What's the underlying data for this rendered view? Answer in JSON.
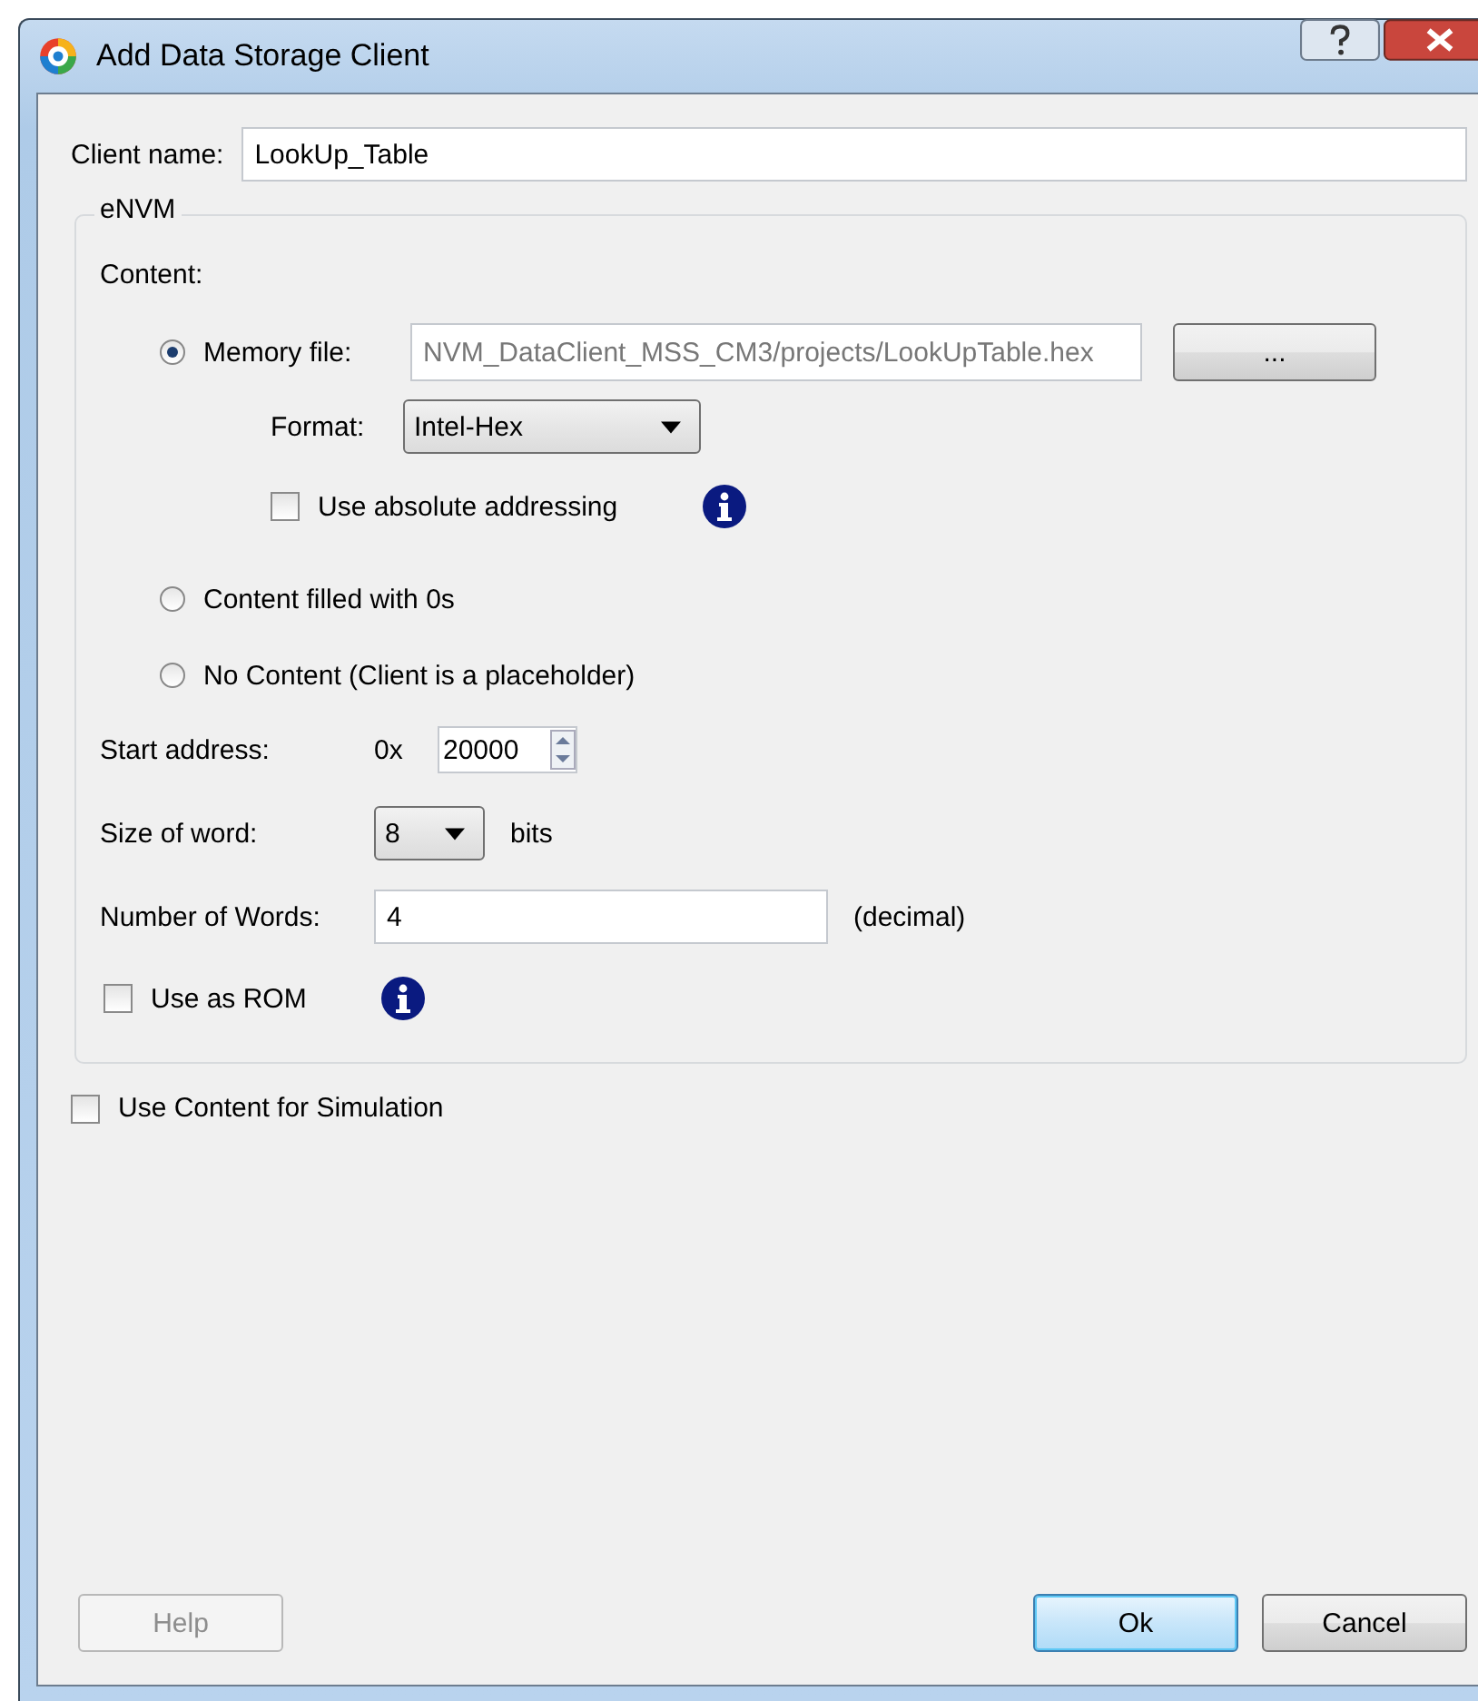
{
  "window": {
    "title": "Add Data Storage Client"
  },
  "client_name": {
    "label": "Client name:",
    "value": "LookUp_Table"
  },
  "group": {
    "title": "eNVM",
    "content_label": "Content:",
    "options": [
      {
        "kind": "file",
        "label": "Memory file:",
        "selected": true,
        "file_value": "NVM_DataClient_MSS_CM3/projects/LookUpTable.hex",
        "browse_label": "...",
        "format_label": "Format:",
        "format_value": "Intel-Hex",
        "absolute": {
          "label": "Use absolute addressing",
          "checked": false
        }
      },
      {
        "kind": "plain",
        "label": "Content filled with 0s",
        "selected": false
      },
      {
        "kind": "plain",
        "label": "No Content (Client is a placeholder)",
        "selected": false
      }
    ],
    "start_address": {
      "label": "Start address:",
      "prefix": "0x",
      "value": "20000"
    },
    "word_size": {
      "label": "Size of word:",
      "value": "8",
      "unit": "bits"
    },
    "number_of_words": {
      "label": "Number of Words:",
      "value": "4",
      "note": "(decimal)"
    },
    "rom": {
      "label": "Use as ROM",
      "checked": false
    }
  },
  "simulation": {
    "label": "Use Content for Simulation",
    "checked": false
  },
  "buttons": [
    {
      "label": "Help",
      "disabled": true,
      "default": false
    },
    {
      "label": "Ok",
      "disabled": false,
      "default": true
    },
    {
      "label": "Cancel",
      "disabled": false,
      "default": false
    }
  ]
}
